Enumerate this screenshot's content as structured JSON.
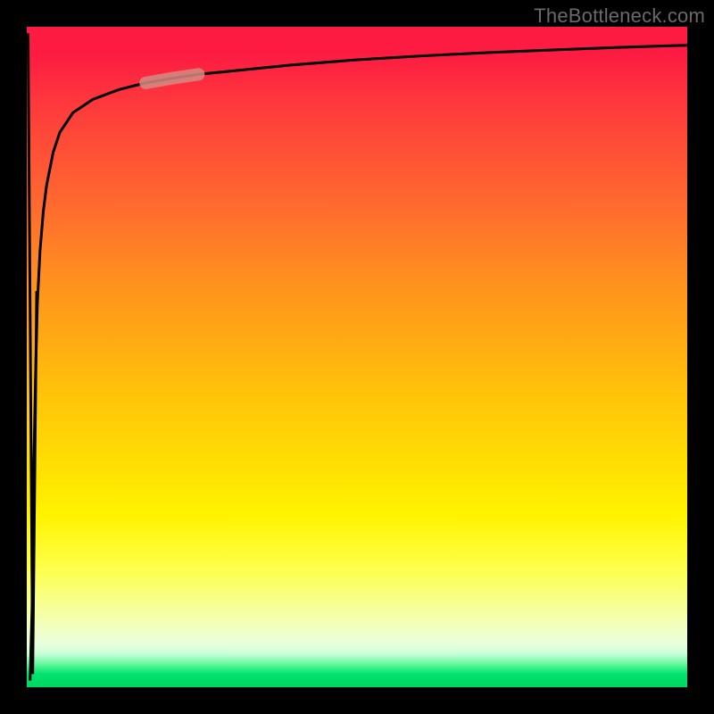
{
  "watermark": "TheBottleneck.com",
  "colors": {
    "frame": "#000000",
    "curve": "#000000",
    "highlight_fill": "#d48b83",
    "gradient_top": "#fd1b42",
    "gradient_bottom": "#00d662"
  },
  "chart_data": {
    "type": "line",
    "title": "",
    "xlabel": "",
    "ylabel": "",
    "xlim": [
      0,
      100
    ],
    "ylim": [
      0,
      100
    ],
    "x": [
      0.5,
      0.8,
      1.0,
      1.3,
      1.6,
      2.0,
      2.5,
      3.0,
      4.0,
      5.0,
      7.0,
      10,
      14,
      18,
      22,
      26,
      30,
      40,
      50,
      60,
      70,
      80,
      90,
      100
    ],
    "values": [
      1,
      12,
      30,
      46,
      58,
      66,
      72,
      76,
      81,
      84,
      87,
      89,
      90.5,
      91.5,
      92.2,
      92.8,
      93.2,
      94.2,
      95,
      95.6,
      96.1,
      96.5,
      96.9,
      97.2
    ],
    "highlight_segment": {
      "x_start": 18,
      "x_end": 26
    },
    "grid": false,
    "legend": false
  }
}
